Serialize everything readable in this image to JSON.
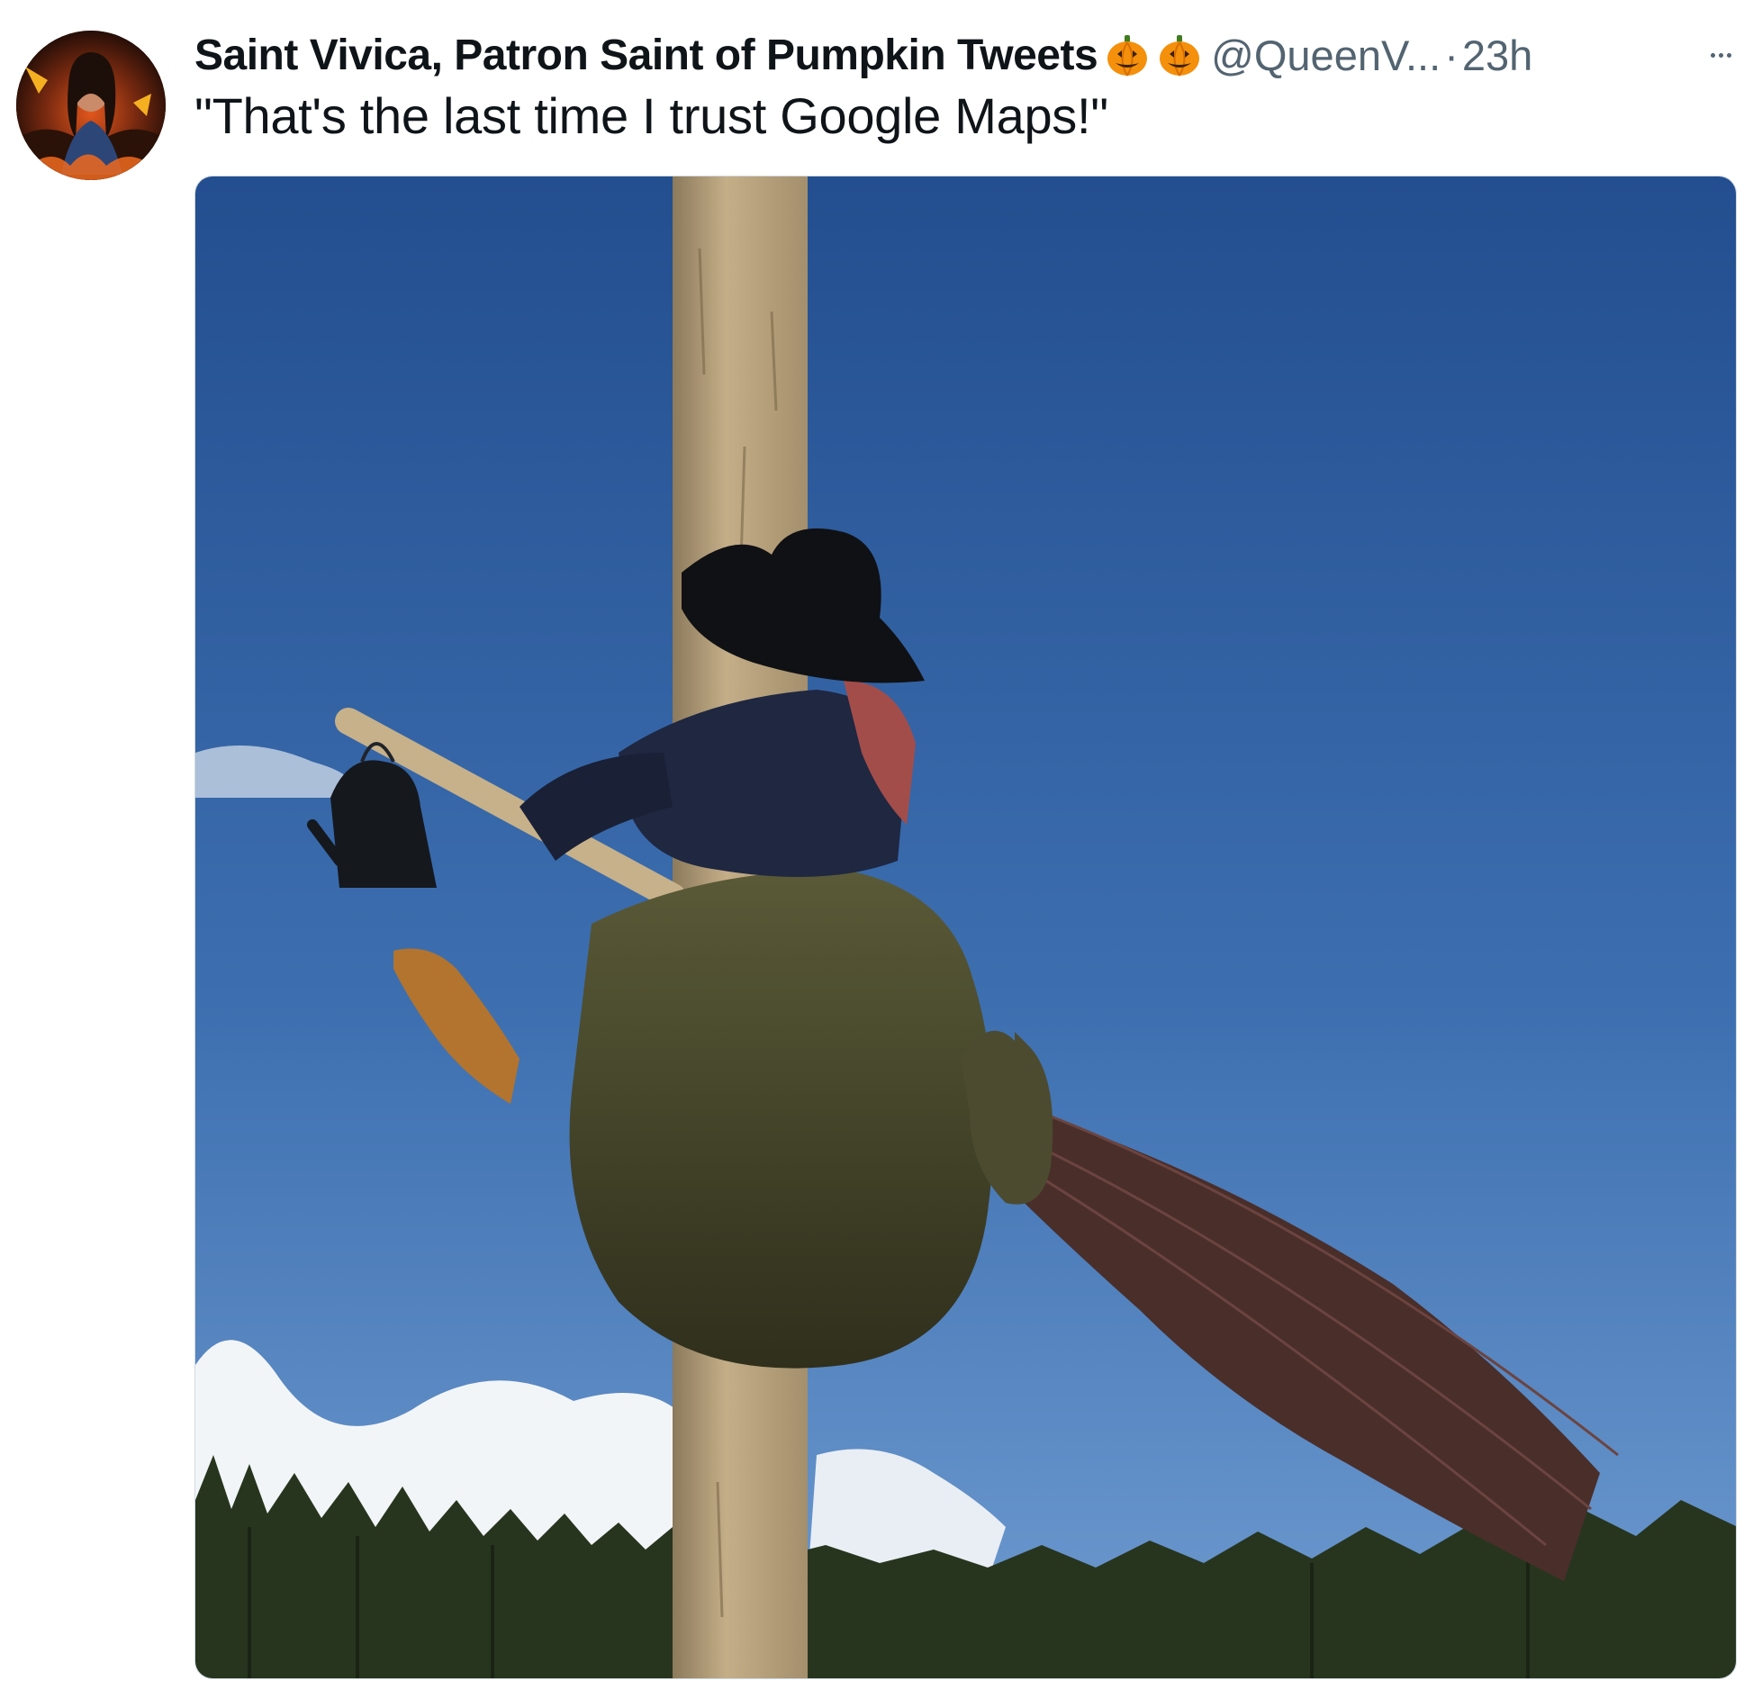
{
  "tweet": {
    "display_name": "Saint Vivica, Patron Saint of Pumpkin Tweets",
    "badges": [
      "pumpkin-emoji",
      "pumpkin-emoji"
    ],
    "handle": "@QueenV...",
    "separator": "·",
    "timestamp": "23h",
    "text": "\"That's the last time I trust Google Maps!\"",
    "more_icon": "more-horizontal-icon",
    "media": {
      "kind": "photo"
    }
  },
  "colors": {
    "name": "#0f1419",
    "secondary": "#536471",
    "border": "#cfd9de",
    "sky": "#3e6fb1"
  }
}
